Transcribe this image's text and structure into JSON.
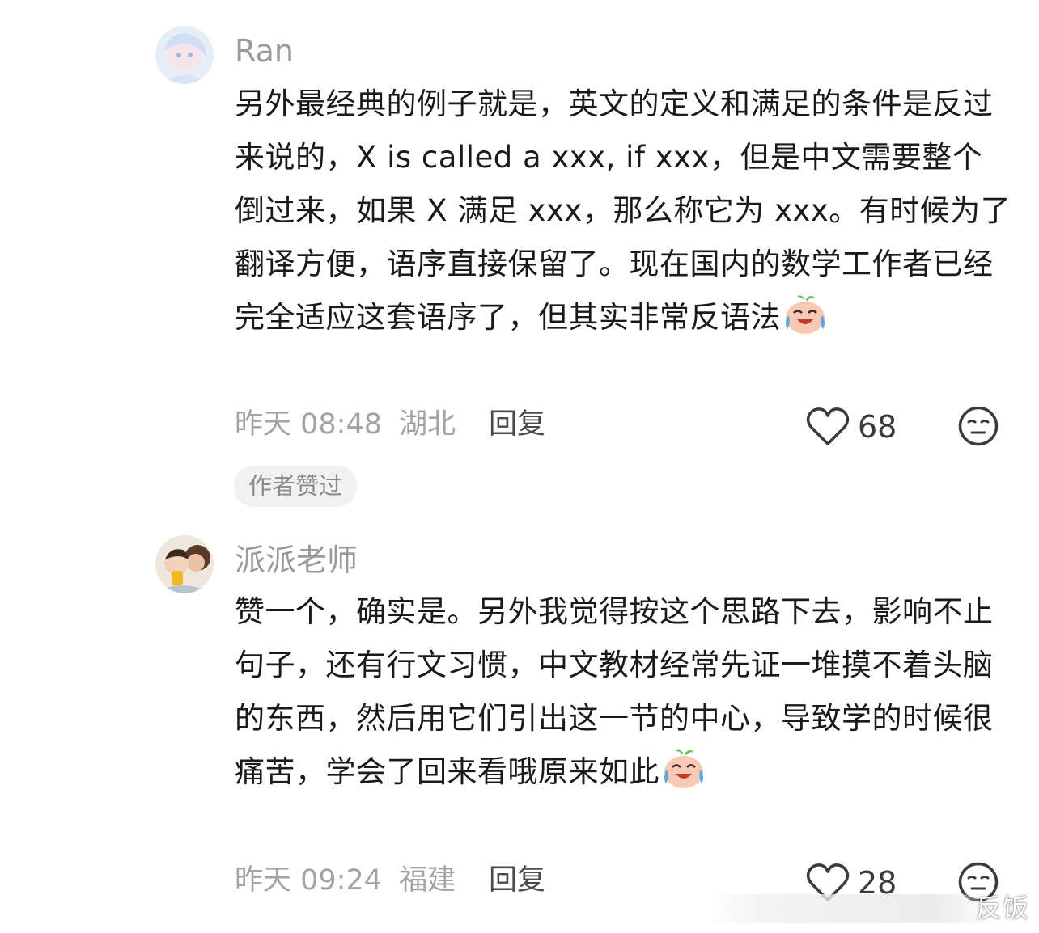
{
  "comments": [
    {
      "username": "Ran",
      "text": "另外最经典的例子就是，英文的定义和满足的条件是反过来说的，X is called a xxx, if xxx，但是中文需要整个倒过来，如果 X 满足 xxx，那么称它为 xxx。有时候为了翻译方便，语序直接保留了。现在国内的数学工作者已经完全适应这套语序了，但其实非常反语法",
      "emoji": "laugh-cry-peach-emoji",
      "time": "昨天 08:48",
      "location": "湖北",
      "reply_label": "回复",
      "likes": "68",
      "badge": "作者赞过"
    },
    {
      "username": "派派老师",
      "text": "赞一个，确实是。另外我觉得按这个思路下去，影响不止句子，还有行文习惯，中文教材经常先证一堆摸不着头脑的东西，然后用它们引出这一节的中心，导致学的时候很痛苦，学会了回来看哦原来如此",
      "emoji": "laugh-cry-peach-emoji",
      "time": "昨天 09:24",
      "location": "福建",
      "reply_label": "回复",
      "likes": "28"
    }
  ],
  "icons": {
    "like": "heart-outline-icon",
    "reaction": "meh-face-icon"
  },
  "watermark": "反饭",
  "colors": {
    "username": "#9a9a9a",
    "meta": "#a3a3a3",
    "badge_bg": "#f1f1f1"
  }
}
